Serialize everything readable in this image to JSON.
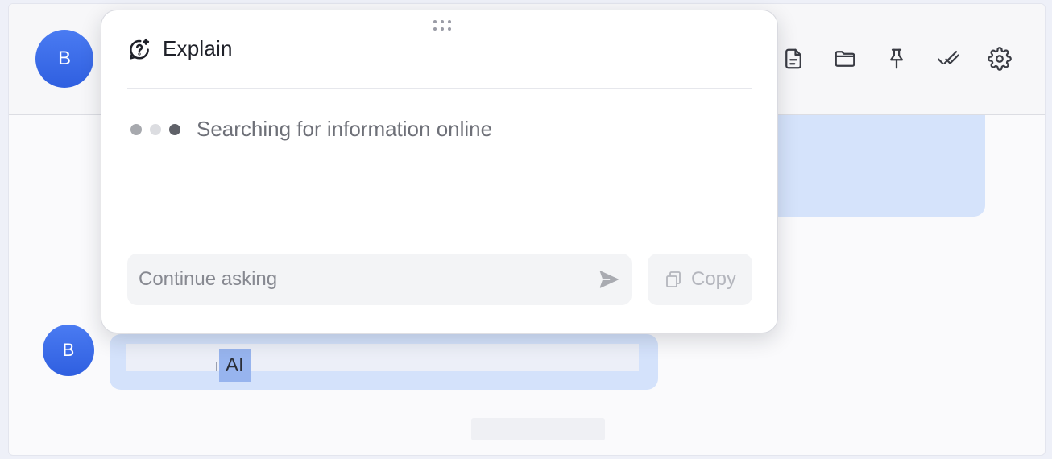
{
  "chat": {
    "top_avatar_initial": "B",
    "bottom_avatar_initial": "B",
    "selected_text": "AI"
  },
  "toolbar": {
    "icons": [
      "document-icon",
      "folder-icon",
      "pin-icon",
      "double-check-icon",
      "gear-icon"
    ]
  },
  "popup": {
    "title": "Explain",
    "icon": "question-sparkle-icon",
    "status_text": "Searching for information online",
    "loading_dot_colors": [
      "#a7a9ae",
      "#dcdde1",
      "#5f6168"
    ],
    "ask_placeholder": "Continue asking",
    "copy_label": "Copy"
  },
  "colors": {
    "accent_blue": "#3a66e6",
    "bubble_blue": "#d5e3fb",
    "highlight": "#97b4ee"
  }
}
